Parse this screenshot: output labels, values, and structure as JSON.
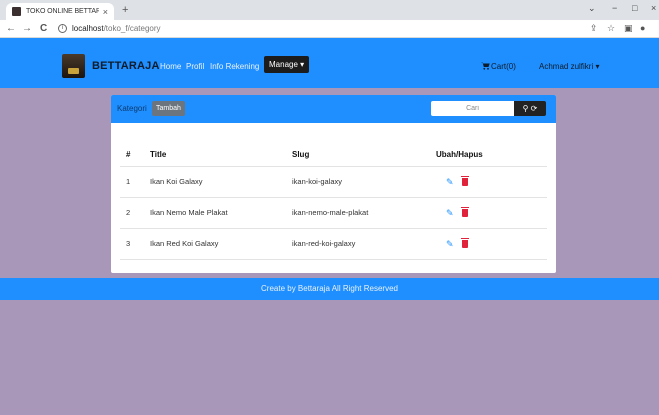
{
  "browser": {
    "tab_title": "TOKO ONLINE BETTARAJA",
    "tab_close": "×",
    "new_tab": "+",
    "url_host": "localhost",
    "url_path": "/toko_f/category",
    "back": "←",
    "forward": "→",
    "reload": "C",
    "info": "i",
    "minimize": "−",
    "restore": "□",
    "close": "×",
    "menu": "⌄",
    "share": "⇪",
    "star": "☆",
    "sidepanel": "▣",
    "profile": "●"
  },
  "navbar": {
    "brand": "BETTARAJA",
    "links": [
      "Home",
      "Profil",
      "Info Rekening"
    ],
    "manage_label": "Manage ▾",
    "cart_label": "Cart(0)",
    "cart_icon": "cart-icon",
    "user_label": "Achmad zulfikri ▾"
  },
  "card": {
    "header_label": "Kategori",
    "add_button": "Tambah",
    "search_placeholder": "Cari",
    "search_btn": "⚲ ⟳"
  },
  "table": {
    "headers": [
      "#",
      "Title",
      "Slug",
      "Ubah/Hapus"
    ],
    "rows": [
      {
        "no": "1",
        "title": "Ikan Koi Galaxy",
        "slug": "ikan-koi-galaxy"
      },
      {
        "no": "2",
        "title": "Ikan Nemo Male Plakat",
        "slug": "ikan-nemo-male-plakat"
      },
      {
        "no": "3",
        "title": "Ikan Red Koi Galaxy",
        "slug": "ikan-red-koi-galaxy"
      }
    ],
    "edit_icon": "edit-icon",
    "delete_icon": "trash-icon"
  },
  "footer": {
    "text": "Create by Bettaraja All Right Reserved"
  },
  "colors": {
    "primary": "#1f8fff",
    "page_bg": "#a997b9",
    "delete": "#e0223a"
  }
}
